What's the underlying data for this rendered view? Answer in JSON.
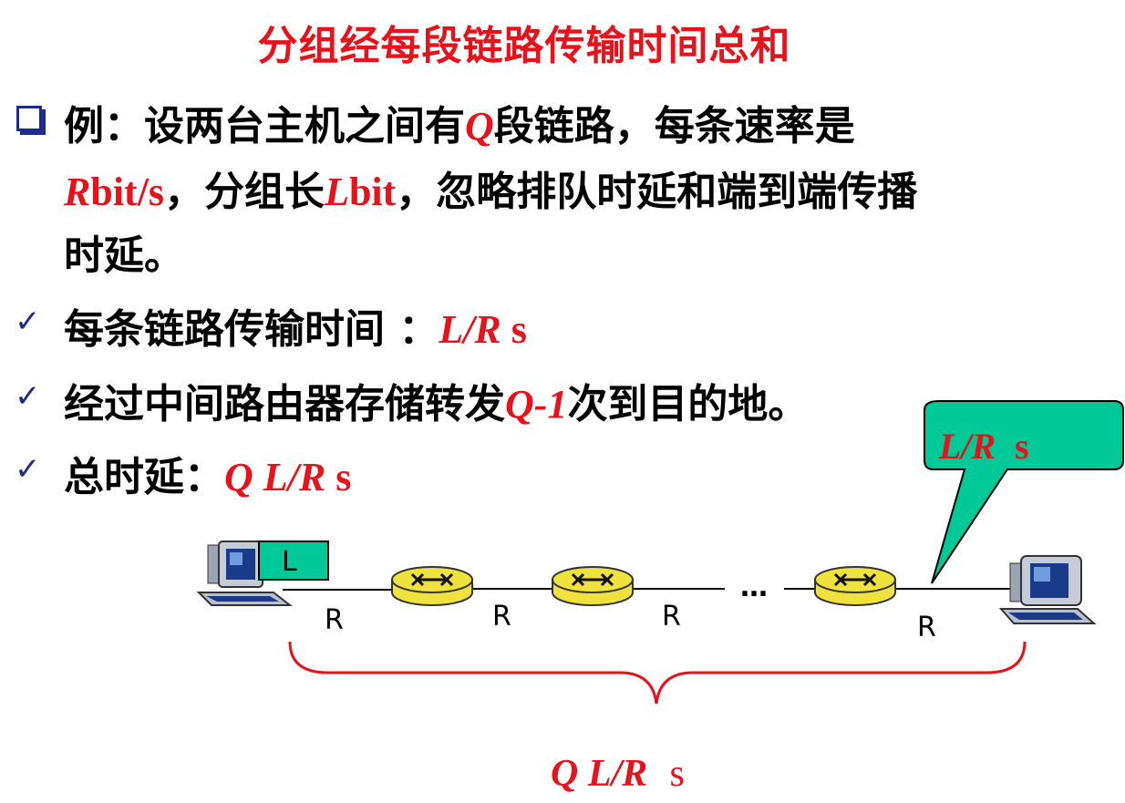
{
  "title": "分组经每段链路传输时间总和",
  "example": {
    "line1_a": "例：设两台主机之间有",
    "line1_q": "Q",
    "line1_b": "段链路，每条速率是",
    "line2_r": "R",
    "line2_r_unit": "bit/s",
    "line2_a": "，分组长",
    "line2_l": "L",
    "line2_l_unit": "bit",
    "line2_b": "，忽略排队时延和端到端传播",
    "line3": "时延。"
  },
  "bullets": [
    {
      "text": "每条链路传输时间 ：",
      "formula": "L/R",
      "unit": " s"
    },
    {
      "text": "经过中间路由器存储转发",
      "formula": "Q-1",
      "after": "次到目的地。"
    },
    {
      "text": "总时延：",
      "formula": "Q L/R",
      "unit": " s"
    }
  ],
  "callout": {
    "formula": "L/R",
    "unit": " s"
  },
  "diagram": {
    "packet_label": "L",
    "link_labels": [
      "R",
      "R",
      "R",
      "R"
    ],
    "ellipsis": "…",
    "brace_formula": "Q L/R",
    "brace_unit": " s"
  },
  "colors": {
    "accent_red": "#e8121a",
    "bullet_blue": "#1b2b8f",
    "callout_fill": "#00c896",
    "router_fill": "#f0e23c"
  }
}
